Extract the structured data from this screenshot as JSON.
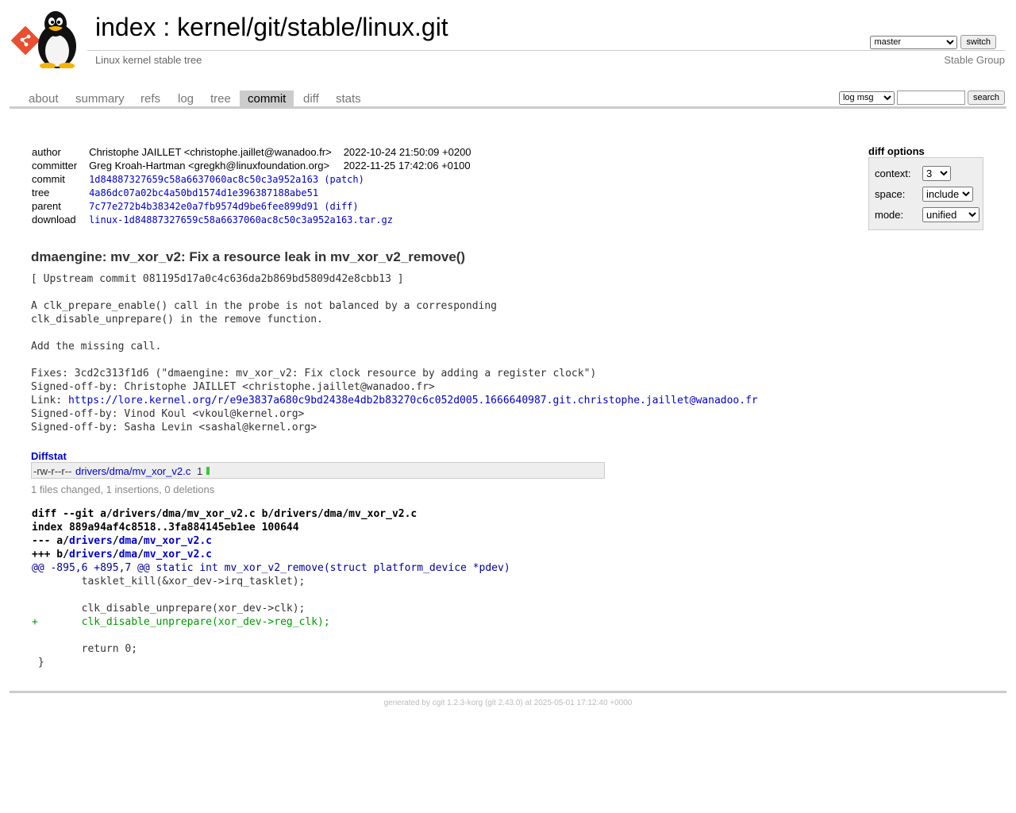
{
  "header": {
    "index_label": "index",
    "separator": " : ",
    "repo_path": "kernel/git/stable/linux.git",
    "description": "Linux kernel stable tree",
    "owner": "Stable Group",
    "branch_selected": "master",
    "switch_label": "switch"
  },
  "tabs": [
    "about",
    "summary",
    "refs",
    "log",
    "tree",
    "commit",
    "diff",
    "stats"
  ],
  "active_tab": "commit",
  "search": {
    "mode_selected": "log msg",
    "query": "",
    "button_label": "search"
  },
  "commit_info": {
    "author_label": "author",
    "author": "Christophe JAILLET <christophe.jaillet@wanadoo.fr>",
    "author_date": "2022-10-24 21:50:09 +0200",
    "committer_label": "committer",
    "committer": "Greg Kroah-Hartman <gregkh@linuxfoundation.org>",
    "committer_date": "2022-11-25 17:42:06 +0100",
    "commit_label": "commit",
    "commit_sha": "1d84887327659c58a6637060ac8c50c3a952a163",
    "patch_label": "(patch)",
    "tree_label": "tree",
    "tree_sha": "4a86dc07a02bc4a50bd1574d1e396387188abe51",
    "parent_label": "parent",
    "parent_sha": "7c77e272b4b38342e0a7fb9574d9be6fee899d91",
    "diff_label": "(diff)",
    "download_label": "download",
    "download_file": "linux-1d84887327659c58a6637060ac8c50c3a952a163.tar.gz"
  },
  "diff_options": {
    "title": "diff options",
    "context_label": "context:",
    "context_value": "3",
    "space_label": "space:",
    "space_value": "include",
    "mode_label": "mode:",
    "mode_value": "unified"
  },
  "subject": "dmaengine: mv_xor_v2: Fix a resource leak in mv_xor_v2_remove()",
  "message": {
    "upstream": "[ Upstream commit 081195d17a0c4c636da2b869bd5809d42e8cbb13 ]",
    "body1": "A clk_prepare_enable() call in the probe is not balanced by a corresponding",
    "body2": "clk_disable_unprepare() in the remove function.",
    "body3": "Add the missing call.",
    "fixes": "Fixes: 3cd2c313f1d6 (\"dmaengine: mv_xor_v2: Fix clock resource by adding a register clock\")",
    "signed1": "Signed-off-by: Christophe JAILLET <christophe.jaillet@wanadoo.fr>",
    "link_prefix": "Link: ",
    "link_url": "https://lore.kernel.org/r/e9e3837a680c9bd2438e4db2b83270c6c052d005.1666640987.git.christophe.jaillet@wanadoo.fr",
    "signed2": "Signed-off-by: Vinod Koul <vkoul@kernel.org>",
    "signed3": "Signed-off-by: Sasha Levin <sashal@kernel.org>"
  },
  "diffstat": {
    "header": "Diffstat",
    "mode": "-rw-r--r--",
    "file": "drivers/dma/mv_xor_v2.c",
    "count": "1",
    "insertions": 1,
    "deletions": 0,
    "summary": "1 files changed, 1 insertions, 0 deletions"
  },
  "diff": {
    "git_line": "diff --git a/drivers/dma/mv_xor_v2.c b/drivers/dma/mv_xor_v2.c",
    "index_line": "index 889a94af4c8518..3fa884145eb1ee 100644",
    "minus_prefix": "--- a/",
    "plus_prefix": "+++ b/",
    "file_dir": "drivers",
    "file_sub": "dma",
    "file_name": "mv_xor_v2.c",
    "hunk": "@@ -895,6 +895,7 @@ static int mv_xor_v2_remove(struct platform_device *pdev)",
    "l1": "        tasklet_kill(&xor_dev->irq_tasklet);",
    "l2": "",
    "l3": "        clk_disable_unprepare(xor_dev->clk);",
    "l4": "+       clk_disable_unprepare(xor_dev->reg_clk);",
    "l5": "",
    "l6": "        return 0;",
    "l7": " }"
  },
  "footer": {
    "prefix": "generated by ",
    "cgit": "cgit 1.2.3-korg",
    "git": "(git 2.43.0)",
    "suffix": " at 2025-05-01 17:12:40 +0000"
  },
  "colors": {
    "link": "#0000cc",
    "tab_active_bg": "#cccccc",
    "added": "#009900",
    "hunk": "#000099"
  }
}
